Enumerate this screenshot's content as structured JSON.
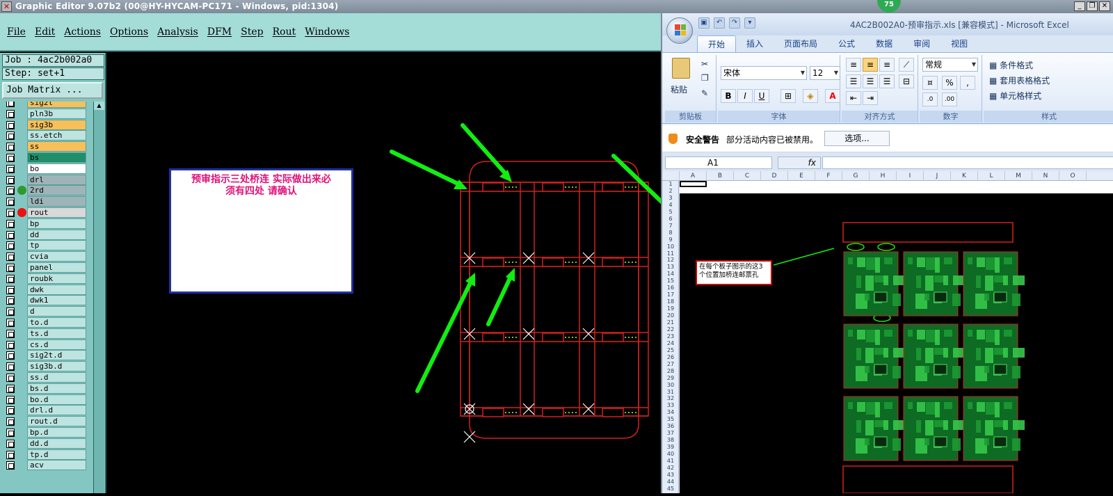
{
  "titlebar": {
    "title": "Graphic Editor 9.07b2 (00@HY-HYCAM-PC171 - Windows, pid:1304)",
    "badge": "75"
  },
  "menu": [
    "File",
    "Edit",
    "Actions",
    "Options",
    "Analysis",
    "DFM",
    "Step",
    "Rout",
    "Windows"
  ],
  "job": {
    "job_label": "Job : 4ac2b002a0",
    "step_label": "Step: set+1",
    "matrix_button": "Job Matrix ..."
  },
  "layers": [
    {
      "name": "sig2t",
      "color": "#f8c05a",
      "dot": ""
    },
    {
      "name": "pln3b",
      "color": "#bde4e0",
      "dot": ""
    },
    {
      "name": "sig3b",
      "color": "#f8c05a",
      "dot": ""
    },
    {
      "name": "ss.etch",
      "color": "#bde4e0",
      "dot": ""
    },
    {
      "name": "ss",
      "color": "#f8c05a",
      "dot": ""
    },
    {
      "name": "bs",
      "color": "#1f8f6a",
      "dot": ""
    },
    {
      "name": "bo",
      "color": "#ffffff",
      "dot": ""
    },
    {
      "name": "drl",
      "color": "#9fb4b8",
      "dot": ""
    },
    {
      "name": "2rd",
      "color": "#9fb4b8",
      "dot": "#2e9a2e"
    },
    {
      "name": "ldi",
      "color": "#9fb4b8",
      "dot": ""
    },
    {
      "name": "rout",
      "color": "#d9d9d9",
      "dot": "#ee1111"
    },
    {
      "name": "bp",
      "color": "#bde4e0",
      "dot": ""
    },
    {
      "name": "dd",
      "color": "#bde4e0",
      "dot": ""
    },
    {
      "name": "tp",
      "color": "#bde4e0",
      "dot": ""
    },
    {
      "name": "cvia",
      "color": "#bde4e0",
      "dot": ""
    },
    {
      "name": "panel",
      "color": "#bde4e0",
      "dot": ""
    },
    {
      "name": "roubk",
      "color": "#bde4e0",
      "dot": ""
    },
    {
      "name": "dwk",
      "color": "#bde4e0",
      "dot": ""
    },
    {
      "name": "dwk1",
      "color": "#bde4e0",
      "dot": ""
    },
    {
      "name": "d",
      "color": "#bde4e0",
      "dot": ""
    },
    {
      "name": "to.d",
      "color": "#bde4e0",
      "dot": ""
    },
    {
      "name": "ts.d",
      "color": "#bde4e0",
      "dot": ""
    },
    {
      "name": "cs.d",
      "color": "#bde4e0",
      "dot": ""
    },
    {
      "name": "sig2t.d",
      "color": "#bde4e0",
      "dot": ""
    },
    {
      "name": "sig3b.d",
      "color": "#bde4e0",
      "dot": ""
    },
    {
      "name": "ss.d",
      "color": "#bde4e0",
      "dot": ""
    },
    {
      "name": "bs.d",
      "color": "#bde4e0",
      "dot": ""
    },
    {
      "name": "bo.d",
      "color": "#bde4e0",
      "dot": ""
    },
    {
      "name": "drl.d",
      "color": "#bde4e0",
      "dot": ""
    },
    {
      "name": "rout.d",
      "color": "#bde4e0",
      "dot": ""
    },
    {
      "name": "bp.d",
      "color": "#bde4e0",
      "dot": ""
    },
    {
      "name": "dd.d",
      "color": "#bde4e0",
      "dot": ""
    },
    {
      "name": "tp.d",
      "color": "#bde4e0",
      "dot": ""
    },
    {
      "name": "acv",
      "color": "#bde4e0",
      "dot": ""
    }
  ],
  "note": {
    "line1": "预审指示三处桥连   实际做出来必",
    "line2": "须有四处   请确认"
  },
  "excel": {
    "doc_title": "4AC2B002A0-预审指示.xls  [兼容模式] - Microsoft Excel",
    "tabs": [
      "开始",
      "插入",
      "页面布局",
      "公式",
      "数据",
      "审阅",
      "视图"
    ],
    "groups": [
      "剪贴板",
      "字体",
      "对齐方式",
      "数字",
      "样式"
    ],
    "paste_label": "粘贴",
    "font_name": "宋体",
    "font_size": "12",
    "number_format": "常规",
    "styles": [
      "条件格式",
      "套用表格格式",
      "单元格样式"
    ],
    "security_title": "安全警告",
    "security_text": "部分活动内容已被禁用。",
    "options_button": "选项...",
    "name_box": "A1",
    "fx": "fx",
    "columns": [
      "A",
      "B",
      "C",
      "D",
      "E",
      "F",
      "G",
      "H",
      "I",
      "J",
      "K",
      "L",
      "M",
      "N",
      "O"
    ],
    "rows": [
      "1",
      "2",
      "3",
      "4",
      "5",
      "6",
      "7",
      "8",
      "9",
      "10",
      "11",
      "12",
      "13",
      "14",
      "15",
      "16",
      "17",
      "18",
      "19",
      "20",
      "21",
      "22",
      "23",
      "24",
      "25",
      "26",
      "27",
      "28",
      "29",
      "30",
      "31",
      "32",
      "33",
      "34",
      "35",
      "36",
      "37",
      "38",
      "39",
      "40",
      "41",
      "42",
      "43",
      "44",
      "45"
    ],
    "callout": "在每个板子图示的这3个位置加桥连邮票孔"
  }
}
